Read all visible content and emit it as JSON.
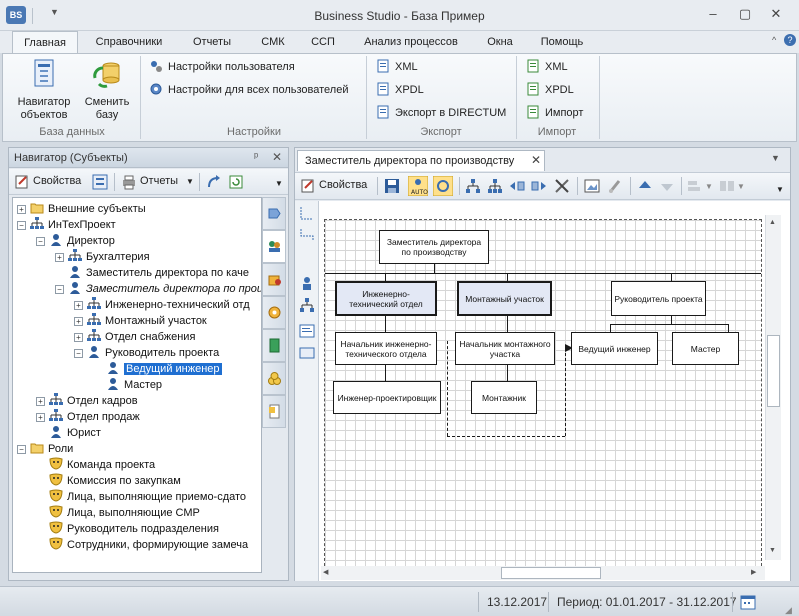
{
  "window": {
    "title": "Business Studio - База Пример"
  },
  "tabs": [
    "Главная",
    "Справочники",
    "Отчеты",
    "СМК",
    "ССП",
    "Анализ процессов",
    "Окна",
    "Помощь"
  ],
  "ribbon": {
    "db": {
      "navigator": "Навигатор\nобъектов",
      "change_db": "Сменить\nбазу",
      "label": "База данных"
    },
    "settings": {
      "user": "Настройки пользователя",
      "all_users": "Настройки для всех пользователей",
      "label": "Настройки"
    },
    "export": {
      "xml": "XML",
      "xpdl": "XPDL",
      "directum": "Экспорт в DIRECTUM",
      "label": "Экспорт"
    },
    "import": {
      "xml": "XML",
      "xpdl": "XPDL",
      "import": "Импорт",
      "label": "Импорт"
    }
  },
  "navigator": {
    "title": "Навигатор (Субъекты)",
    "properties": "Свойства",
    "reports": "Отчеты",
    "tree": [
      {
        "label": "Внешние субъекты",
        "level": 0,
        "icon": "folder",
        "expander": "+"
      },
      {
        "label": "ИнТехПроект",
        "level": 0,
        "icon": "org",
        "expander": "−"
      },
      {
        "label": "Директор",
        "level": 1,
        "icon": "person",
        "expander": "−"
      },
      {
        "label": "Бухгалтерия",
        "level": 2,
        "icon": "org",
        "expander": "+"
      },
      {
        "label": "Заместитель директора по каче",
        "level": 2,
        "icon": "person",
        "expander": ""
      },
      {
        "label": "Заместитель директора по прои",
        "level": 2,
        "icon": "person",
        "expander": "−",
        "italic": true
      },
      {
        "label": "Инженерно-технический отд",
        "level": 3,
        "icon": "org",
        "expander": "+"
      },
      {
        "label": "Монтажный участок",
        "level": 3,
        "icon": "org",
        "expander": "+"
      },
      {
        "label": "Отдел снабжения",
        "level": 3,
        "icon": "org",
        "expander": "+"
      },
      {
        "label": "Руководитель проекта",
        "level": 3,
        "icon": "person",
        "expander": "−"
      },
      {
        "label": "Ведущий инженер",
        "level": 4,
        "icon": "person",
        "expander": "",
        "selected": true
      },
      {
        "label": "Мастер",
        "level": 4,
        "icon": "person",
        "expander": ""
      },
      {
        "label": "Отдел кадров",
        "level": 1,
        "icon": "org",
        "expander": "+"
      },
      {
        "label": "Отдел продаж",
        "level": 1,
        "icon": "org",
        "expander": "+"
      },
      {
        "label": "Юрист",
        "level": 1,
        "icon": "person",
        "expander": ""
      },
      {
        "label": "Роли",
        "level": 0,
        "icon": "folder",
        "expander": "−"
      },
      {
        "label": "Команда проекта",
        "level": 1,
        "icon": "role",
        "expander": ""
      },
      {
        "label": "Комиссия по закупкам",
        "level": 1,
        "icon": "role",
        "expander": ""
      },
      {
        "label": "Лица, выполняющие приемо-сдато",
        "level": 1,
        "icon": "role",
        "expander": ""
      },
      {
        "label": "Лица, выполняющие СМР",
        "level": 1,
        "icon": "role",
        "expander": ""
      },
      {
        "label": "Руководитель подразделения",
        "level": 1,
        "icon": "role",
        "expander": ""
      },
      {
        "label": "Сотрудники, формирующие замеча",
        "level": 1,
        "icon": "role",
        "expander": ""
      }
    ]
  },
  "diagram": {
    "tab_title": "Заместитель директора по производству",
    "properties": "Свойства",
    "nodes": {
      "root": "Заместитель директора по производству",
      "eng_dept": "Инженерно-технический отдел",
      "install": "Монтажный участок",
      "pm": "Руководитель проекта",
      "eng_head": "Начальник инженерно-технического отдела",
      "inst_head": "Начальник монтажного участка",
      "lead_eng": "Ведущий инженер",
      "master": "Мастер",
      "designer": "Инженер-проектировщик",
      "installer": "Монтажник"
    }
  },
  "status": {
    "date": "13.12.2017",
    "period": "Период: 01.01.2017 - 31.12.2017"
  }
}
